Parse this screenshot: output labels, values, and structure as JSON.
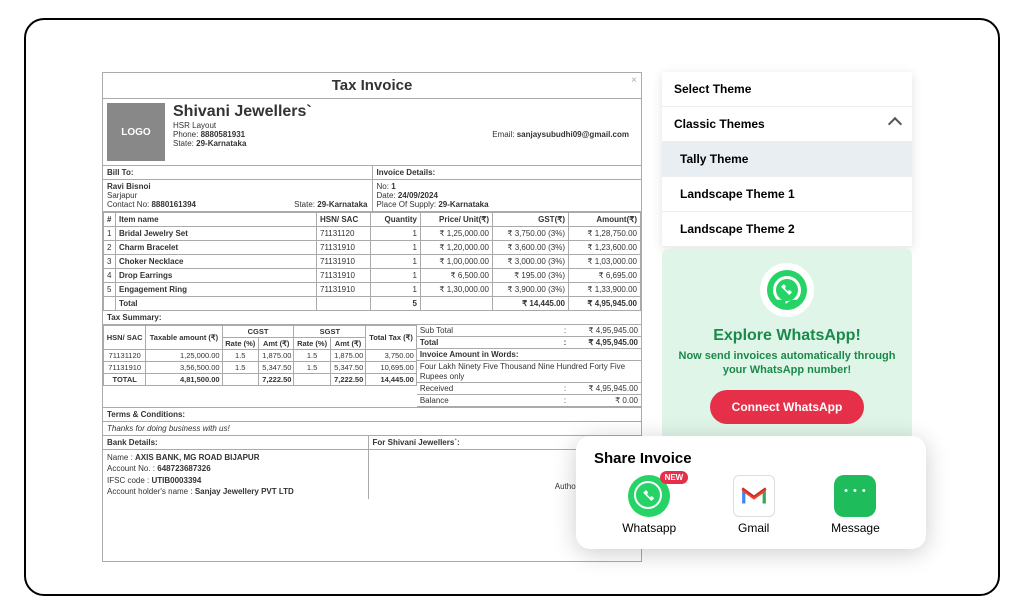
{
  "invoice": {
    "title": "Tax Invoice",
    "logo_text": "LOGO",
    "shop": {
      "name": "Shivani Jewellers`",
      "addr": "HSR Layout",
      "phone_label": "Phone:",
      "phone": "8880581931",
      "email_label": "Email:",
      "email": "sanjaysubudhi09@gmail.com",
      "state_label": "State:",
      "state": "29-Karnataka"
    },
    "bill_to_label": "Bill To:",
    "invoice_details_label": "Invoice Details:",
    "customer": {
      "name": "Ravi Bisnoi",
      "addr": "Sarjapur",
      "contact_label": "Contact No:",
      "contact": "8880161394",
      "state_label": "State:",
      "state": "29-Karnataka"
    },
    "details": {
      "no_label": "No:",
      "no": "1",
      "date_label": "Date:",
      "date": "24/09/2024",
      "pos_label": "Place Of Supply:",
      "pos": "29-Karnataka"
    },
    "cols": {
      "n": "#",
      "item": "Item name",
      "hsn": "HSN/ SAC",
      "qty": "Quantity",
      "price": "Price/ Unit(₹)",
      "gst": "GST(₹)",
      "amt": "Amount(₹)"
    },
    "items": [
      {
        "n": "1",
        "name": "Bridal Jewelry Set",
        "hsn": "71131120",
        "qty": "1",
        "price": "₹ 1,25,000.00",
        "gst": "₹ 3,750.00 (3%)",
        "amt": "₹ 1,28,750.00"
      },
      {
        "n": "2",
        "name": "Charm Bracelet",
        "hsn": "71131910",
        "qty": "1",
        "price": "₹ 1,20,000.00",
        "gst": "₹ 3,600.00 (3%)",
        "amt": "₹ 1,23,600.00"
      },
      {
        "n": "3",
        "name": "Choker Necklace",
        "hsn": "71131910",
        "qty": "1",
        "price": "₹ 1,00,000.00",
        "gst": "₹ 3,000.00 (3%)",
        "amt": "₹ 1,03,000.00"
      },
      {
        "n": "4",
        "name": "Drop Earrings",
        "hsn": "71131910",
        "qty": "1",
        "price": "₹ 6,500.00",
        "gst": "₹ 195.00 (3%)",
        "amt": "₹ 6,695.00"
      },
      {
        "n": "5",
        "name": "Engagement Ring",
        "hsn": "71131910",
        "qty": "1",
        "price": "₹ 1,30,000.00",
        "gst": "₹ 3,900.00 (3%)",
        "amt": "₹ 1,33,900.00"
      }
    ],
    "total_row": {
      "label": "Total",
      "qty": "5",
      "gst": "₹ 14,445.00",
      "amt": "₹ 4,95,945.00"
    },
    "tax_summary_label": "Tax Summary:",
    "tax_cols": {
      "hsn": "HSN/ SAC",
      "taxable": "Taxable amount (₹)",
      "cgst": "CGST",
      "sgst": "SGST",
      "rate": "Rate (%)",
      "amt": "Amt (₹)",
      "total": "Total Tax (₹)"
    },
    "tax_rows": [
      {
        "hsn": "71131120",
        "taxable": "1,25,000.00",
        "cr": "1.5",
        "ca": "1,875.00",
        "sr": "1.5",
        "sa": "1,875.00",
        "tot": "3,750.00"
      },
      {
        "hsn": "71131910",
        "taxable": "3,56,500.00",
        "cr": "1.5",
        "ca": "5,347.50",
        "sr": "1.5",
        "sa": "5,347.50",
        "tot": "10,695.00"
      }
    ],
    "tax_total": {
      "label": "TOTAL",
      "taxable": "4,81,500.00",
      "ca": "7,222.50",
      "sa": "7,222.50",
      "tot": "14,445.00"
    },
    "summary": {
      "subtotal_l": "Sub Total",
      "subtotal_v": "₹ 4,95,945.00",
      "total_l": "Total",
      "total_v": "₹ 4,95,945.00",
      "words_l": "Invoice Amount in Words:",
      "words_v": "Four Lakh Ninety Five Thousand Nine Hundred Forty Five Rupees only",
      "recv_l": "Received",
      "recv_v": "₹ 4,95,945.00",
      "bal_l": "Balance",
      "bal_v": "₹ 0.00"
    },
    "terms_label": "Terms & Conditions:",
    "thanks": "Thanks for doing business with us!",
    "bank_label": "Bank Details:",
    "for_label": "For Shivani Jewellers`:",
    "bank": {
      "name_l": "Name :",
      "name": "AXIS BANK, MG ROAD BIJAPUR",
      "acc_l": "Account No. :",
      "acc": "648723687326",
      "ifsc_l": "IFSC code :",
      "ifsc": "UTIB0003394",
      "holder_l": "Account holder's name :",
      "holder": "Sanjay Jewellery PVT LTD"
    },
    "auth_sig": "Authorized Signatory"
  },
  "themes": {
    "title": "Select Theme",
    "category": "Classic Themes",
    "items": [
      "Tally Theme",
      "Landscape Theme 1",
      "Landscape Theme 2"
    ],
    "selected": 0
  },
  "whatsapp": {
    "title": "Explore WhatsApp!",
    "subtitle": "Now send invoices automatically through your WhatsApp number!",
    "button": "Connect WhatsApp"
  },
  "share": {
    "title": "Share Invoice",
    "new_badge": "NEW",
    "options": [
      "Whatsapp",
      "Gmail",
      "Message"
    ]
  }
}
